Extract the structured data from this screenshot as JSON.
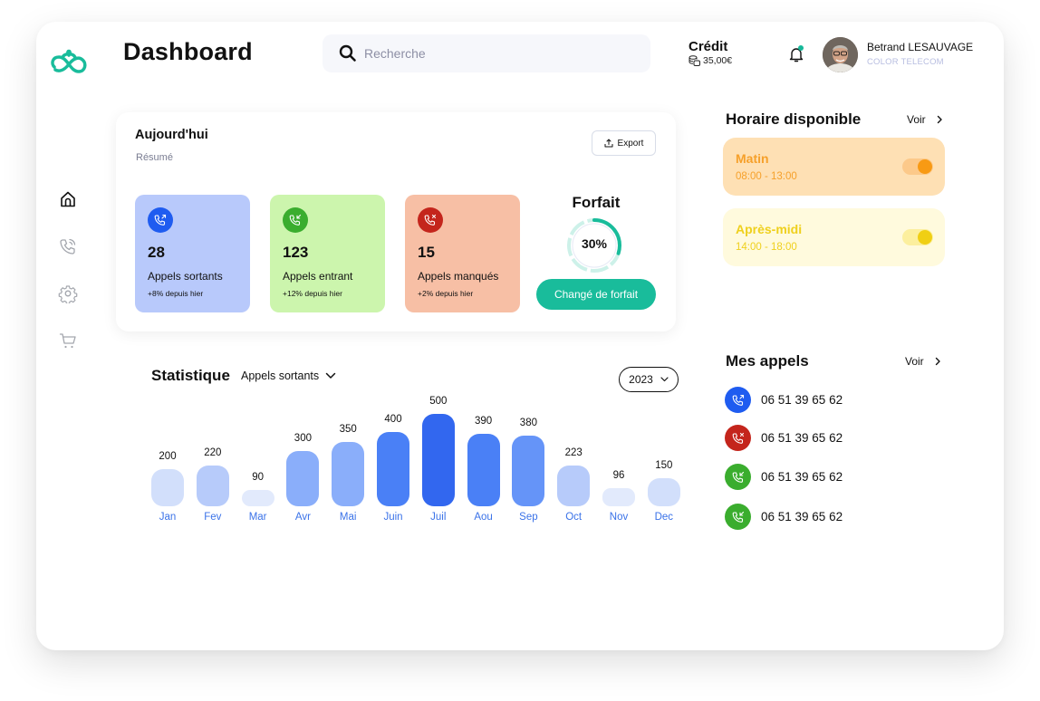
{
  "header": {
    "title": "Dashboard",
    "search": {
      "placeholder": "Recherche",
      "value": ""
    },
    "credit": {
      "label": "Crédit",
      "value": "35,00€"
    },
    "notifications": {
      "has_unread": true
    },
    "user": {
      "name": "Betrand LESAUVAGE",
      "company": "COLOR TELECOM"
    }
  },
  "sidebar": {
    "items": [
      {
        "icon": "home-icon",
        "active": true
      },
      {
        "icon": "phone-icon",
        "active": false
      },
      {
        "icon": "gear-icon",
        "active": false
      },
      {
        "icon": "cart-icon",
        "active": false
      }
    ]
  },
  "today": {
    "title": "Aujourd'hui",
    "subtitle": "Résumé",
    "export_label": "Export",
    "stats": [
      {
        "value": "28",
        "label": "Appels sortants",
        "delta": "+8% depuis hier",
        "type": "outgoing",
        "bg": "#b8c9fb",
        "icon_bg": "#1f5cf0"
      },
      {
        "value": "123",
        "label": "Appels entrant",
        "delta": "+12% depuis hier",
        "type": "incoming",
        "bg": "#ccf5ad",
        "icon_bg": "#3aad2e"
      },
      {
        "value": "15",
        "label": "Appels manqués",
        "delta": "+2% depuis hier",
        "type": "missed",
        "bg": "#f7bfa5",
        "icon_bg": "#c4251c"
      }
    ],
    "forfait": {
      "title": "Forfait",
      "percent": 30,
      "percent_label": "30%",
      "button_label": "Changé de forfait"
    }
  },
  "statistique": {
    "title": "Statistique",
    "filter": "Appels sortants",
    "year": "2023"
  },
  "chart_data": {
    "type": "bar",
    "title": "Statistique",
    "series_name": "Appels sortants",
    "categories": [
      "Jan",
      "Fev",
      "Mar",
      "Avr",
      "Mai",
      "Juin",
      "Juil",
      "Aou",
      "Sep",
      "Oct",
      "Nov",
      "Dec"
    ],
    "values": [
      200,
      220,
      90,
      300,
      350,
      400,
      500,
      390,
      380,
      223,
      96,
      150
    ],
    "xlabel": "",
    "ylabel": "",
    "ylim": [
      0,
      500
    ],
    "grid": false,
    "legend": "none"
  },
  "horaire": {
    "title": "Horaire disponible",
    "voir_label": "Voir",
    "slots": [
      {
        "name": "Matin",
        "time": "08:00 - 13:00",
        "enabled": true,
        "bg": "#fee0b4",
        "text": "#f6a02a",
        "track": "#fcc98a",
        "knob": "#f89a14"
      },
      {
        "name": "Après-midi",
        "time": "14:00 - 18:00",
        "enabled": true,
        "bg": "#fffadd",
        "text": "#efd01d",
        "track": "#fcef9e",
        "knob": "#f0cf14"
      }
    ]
  },
  "appels": {
    "title": "Mes appels",
    "voir_label": "Voir",
    "items": [
      {
        "number": "06 51 39 65 62",
        "type": "outgoing",
        "color": "#1f5cf0"
      },
      {
        "number": "06 51 39 65 62",
        "type": "missed",
        "color": "#c4251c"
      },
      {
        "number": "06 51 39 65 62",
        "type": "incoming",
        "color": "#3aad2e"
      },
      {
        "number": "06 51 39 65 62",
        "type": "incoming",
        "color": "#3aad2e"
      }
    ]
  },
  "colors": {
    "brand": "#19bc9b",
    "chart_label": "#3a72e8"
  }
}
